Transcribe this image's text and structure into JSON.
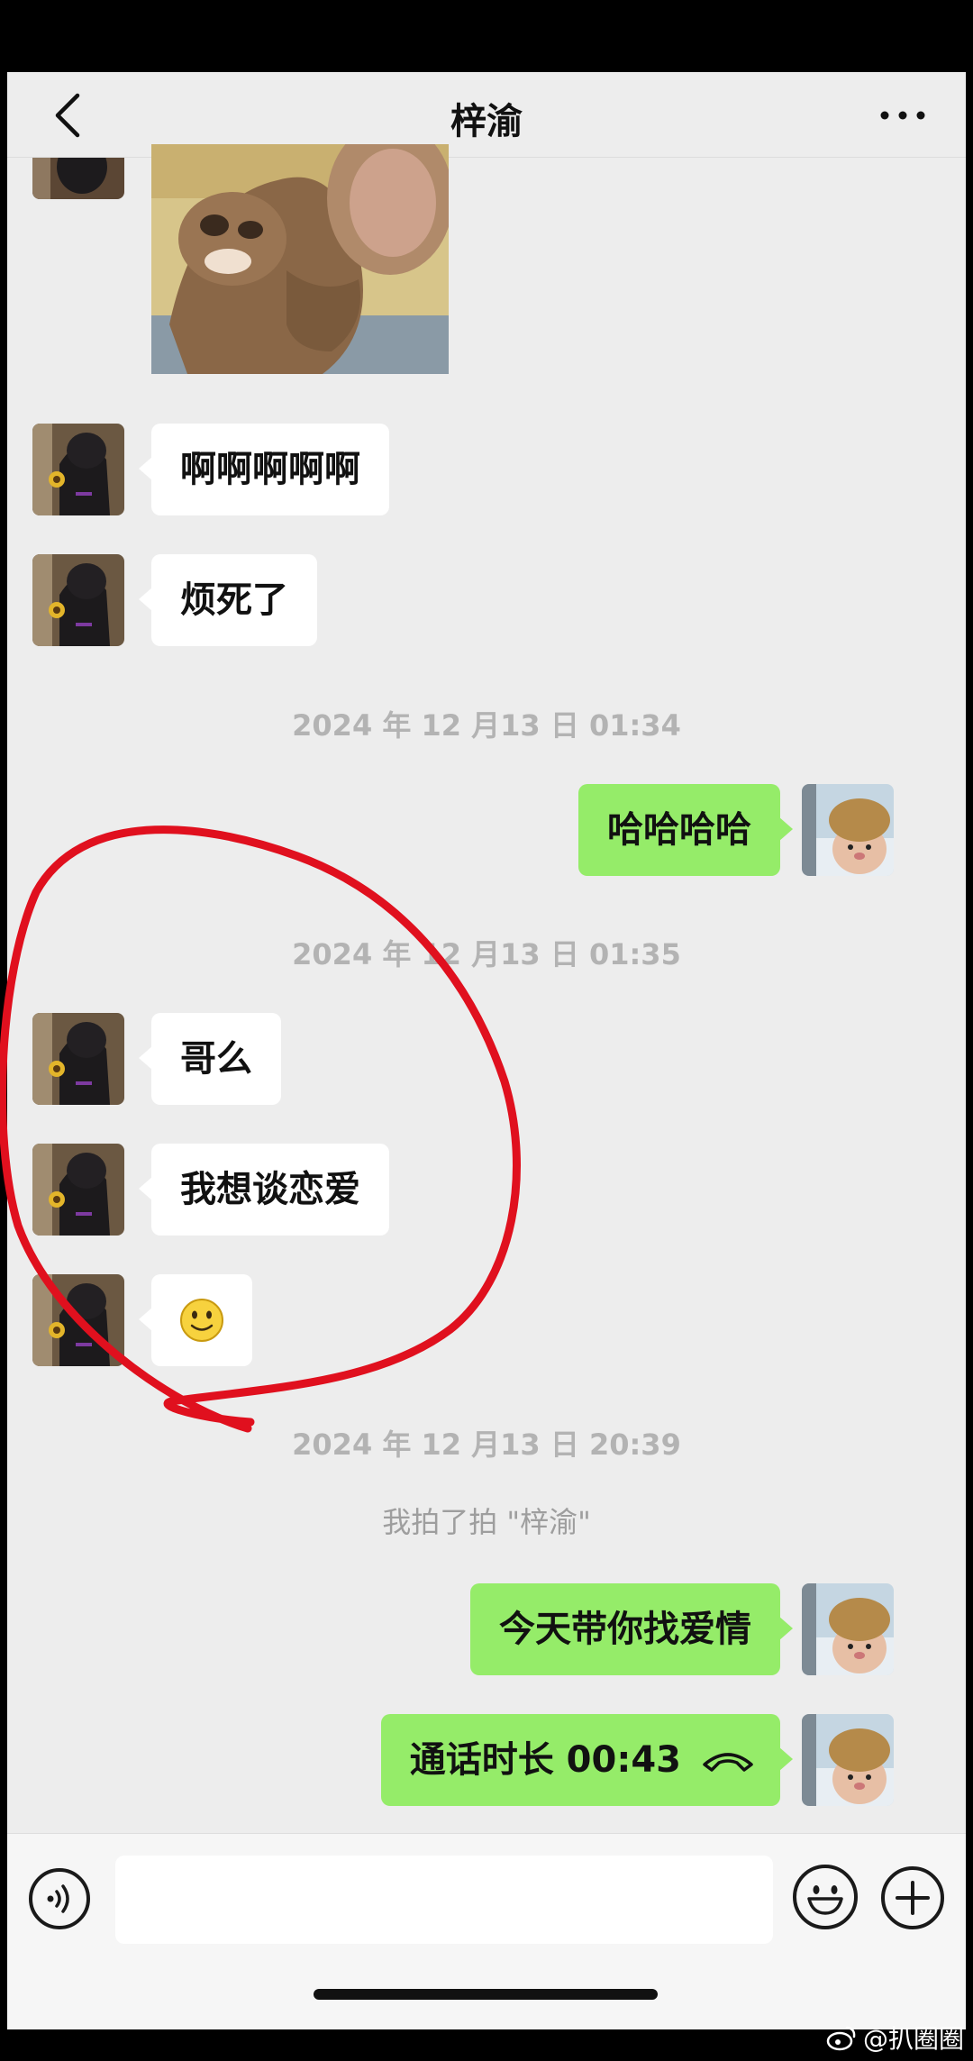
{
  "header": {
    "title": "梓渝",
    "back_icon": "chevron-left-icon",
    "more_icon": "more-dots-icon"
  },
  "messages": {
    "m1": "啊啊啊啊啊",
    "m2": "烦死了",
    "ts1": "2024 年 12 月13 日 01:34",
    "m3": "哈哈哈哈",
    "ts2": "2024 年 12 月13 日 01:35",
    "m4": "哥么",
    "m5": "我想谈恋爱",
    "m6": "🙂",
    "ts3": "2024 年 12 月13 日 20:39",
    "sys1": "我拍了拍 \"梓渝\"",
    "m7": "今天带你找爱情",
    "m8": "通话时长 00:43"
  },
  "bottom_bar": {
    "voice_icon": "voice-icon",
    "emoji_icon": "emoji-icon",
    "plus_icon": "plus-icon"
  },
  "watermark": {
    "text": "@扒圈圈",
    "icon": "weibo-icon"
  },
  "colors": {
    "background": "#ededed",
    "bubble_self": "#95ec69",
    "bubble_other": "#ffffff",
    "annotation": "#e0101e"
  }
}
